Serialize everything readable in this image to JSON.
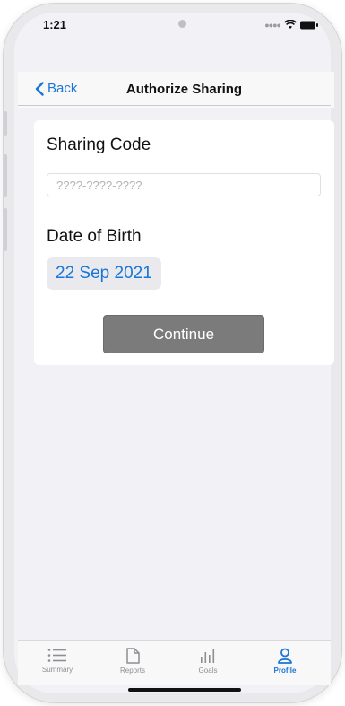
{
  "status_bar": {
    "time": "1:21"
  },
  "nav": {
    "back_label": "Back",
    "title": "Authorize Sharing"
  },
  "form": {
    "sharing_code_label": "Sharing Code",
    "sharing_code_placeholder": "????-????-????",
    "sharing_code_value": "",
    "dob_label": "Date of Birth",
    "dob_value": "22 Sep 2021",
    "continue_label": "Continue"
  },
  "tabs": [
    {
      "label": "Summary",
      "icon": "list-icon",
      "active": false
    },
    {
      "label": "Reports",
      "icon": "document-icon",
      "active": false
    },
    {
      "label": "Goals",
      "icon": "bar-chart-icon",
      "active": false
    },
    {
      "label": "Profile",
      "icon": "person-icon",
      "active": true
    }
  ],
  "colors": {
    "accent": "#1976d6",
    "button": "#7b7b7b",
    "background": "#f2f2f6"
  }
}
